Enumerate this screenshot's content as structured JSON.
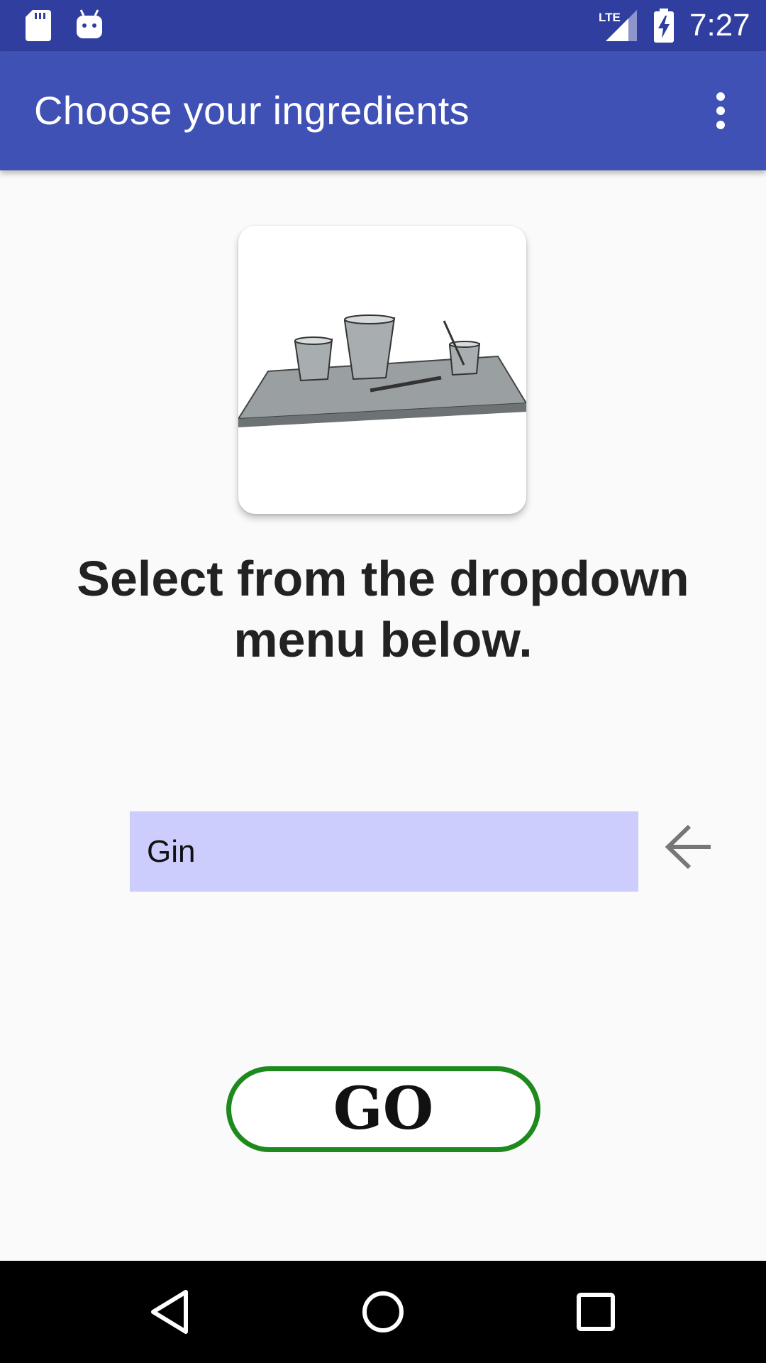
{
  "status_bar": {
    "time": "7:27",
    "network": "LTE",
    "icons": [
      "sd-card-icon",
      "android-debug-icon",
      "lte-signal-icon",
      "battery-charging-icon"
    ]
  },
  "app_bar": {
    "title": "Choose your ingredients",
    "menu_icon": "overflow-menu-icon"
  },
  "main": {
    "image_description_icon": "bar-tray-icon",
    "heading": "Select from the dropdown menu below.",
    "dropdown": {
      "selected": "Gin"
    },
    "back_icon": "arrow-back-icon",
    "go_label": "GO"
  },
  "nav_bar": {
    "icons": [
      "nav-back-icon",
      "nav-home-icon",
      "nav-recents-icon"
    ]
  },
  "colors": {
    "status_bar": "#303f9f",
    "app_bar": "#3f51b5",
    "dropdown_bg": "#cdcdfd",
    "go_border": "#1e8a1e"
  }
}
